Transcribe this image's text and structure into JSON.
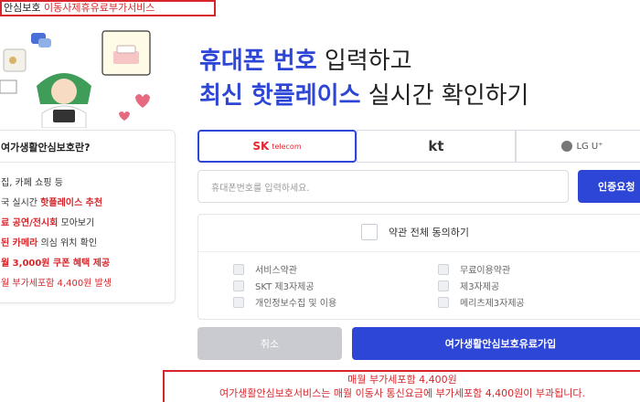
{
  "top_notice": {
    "prefix": "안심보호",
    "highlight": "이동사제휴유료부가서비스"
  },
  "headline": {
    "line1_accent": "휴대폰 번호",
    "line1_rest": " 입력하고",
    "line2_accent": "최신 핫플레이스",
    "line2_rest": " 실시간 확인하기"
  },
  "info_card": {
    "title": "여가생활안심보호란?",
    "lines": [
      {
        "pre": "집, 카페 쇼핑 등",
        "hl": "",
        "post": ""
      },
      {
        "pre": "국 실시간 ",
        "hl": "핫플레이스 추천",
        "post": ""
      },
      {
        "pre": "",
        "hl": "료 공연/전시회",
        "post": " 모아보기"
      },
      {
        "pre": "",
        "hl": "된 카메라",
        "post": " 의심 위치 확인"
      },
      {
        "pre": "",
        "hl": "월 3,000원 쿠폰 혜택 제공",
        "post": ""
      },
      {
        "pre": "",
        "hl": "",
        "post": "월 부가세포함 4,400원 발생"
      }
    ]
  },
  "carriers": {
    "sk": {
      "brand": "SK",
      "sub": "telecom"
    },
    "kt": "kt",
    "lgu": "LG U⁺"
  },
  "phone": {
    "placeholder": "휴대폰번호를 입력하세요.",
    "verify_label": "인증요청"
  },
  "terms": {
    "all_label": "약관 전체 동의하기",
    "items": [
      "서비스약관",
      "무료이용약관",
      "SKT 제3자제공",
      "제3자제공",
      "개인정보수집 및 이용",
      "메리츠제3자제공"
    ]
  },
  "buttons": {
    "cancel": "취소",
    "join": "여가생활안심보호유료가입"
  },
  "bottom_notice": {
    "line1": "매월 부가세포함 4,400원",
    "line2": "여가생활안심보호서비스는 매월 이동사 통신요금에 부가세포함 4,400원이 부과됩니다."
  },
  "colors": {
    "accent": "#2e46d6",
    "notice_red": "#d7262b"
  }
}
